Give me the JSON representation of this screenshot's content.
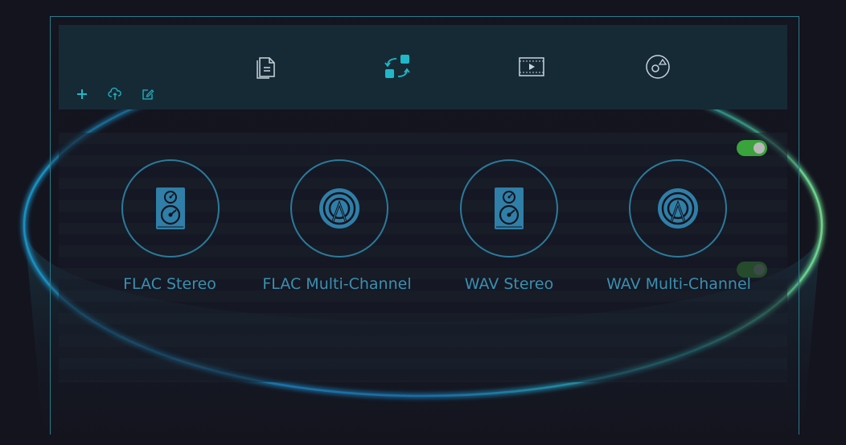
{
  "icons": {
    "documents": "documents-icon",
    "convert": "convert-icon",
    "video": "video-icon",
    "disc": "disc-icon",
    "add": "plus-icon",
    "upload": "cloud-upload-icon",
    "edit": "edit-icon"
  },
  "colors": {
    "accent": "#1fa8c0",
    "label": "#3a8fb0",
    "toggle_on": "#3aa33c",
    "toggle_dim": "#2a5a2e"
  },
  "formats": [
    {
      "label": "FLAC Stereo",
      "icon": "speaker-icon"
    },
    {
      "label": "FLAC Multi-Channel",
      "icon": "broadcast-icon"
    },
    {
      "label": "WAV Stereo",
      "icon": "speaker-icon"
    },
    {
      "label": "WAV Multi-Channel",
      "icon": "broadcast-icon"
    }
  ],
  "toggles": [
    {
      "state": "on"
    },
    {
      "state": "dim"
    }
  ]
}
